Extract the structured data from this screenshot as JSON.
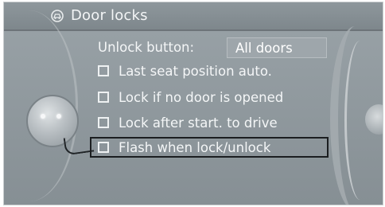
{
  "window": {
    "title": "Door locks",
    "title_icon": "car-door-icon"
  },
  "settings": {
    "unlock_label": "Unlock button:",
    "unlock_value": "All doors",
    "options": [
      {
        "label": "Last seat position auto.",
        "checked": false
      },
      {
        "label": "Lock if no door is opened",
        "checked": false
      },
      {
        "label": "Lock after start. to drive",
        "checked": false
      },
      {
        "label": "Flash when lock/unlock",
        "checked": false,
        "selected": true
      }
    ]
  },
  "colors": {
    "background": "#8f989d",
    "text": "#f4f6f7",
    "selection_border": "#1b1e20"
  }
}
